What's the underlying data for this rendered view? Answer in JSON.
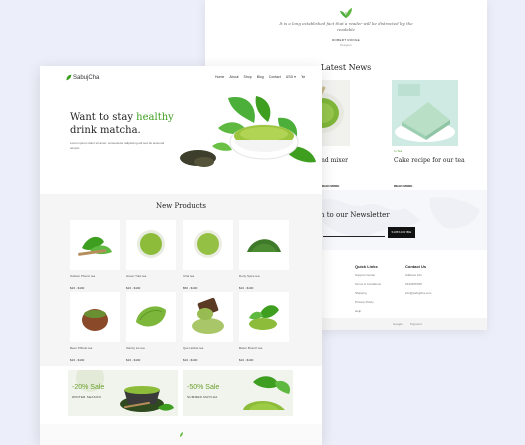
{
  "back": {
    "testimonial": {
      "quote": "It is a long established fact that a reader will be distracted by the readable",
      "author": "ROBERT RODGE",
      "role": "Designer"
    },
    "news_title": "Latest News",
    "news": [
      {
        "date": "",
        "title": "nd mixer",
        "more": "READ MORE"
      },
      {
        "date": "",
        "title": "Cake recipe for our tea",
        "more": "READ MORE"
      }
    ],
    "newsletter": {
      "title": "n to our Newsletter",
      "button": "SUBSCRIBE"
    },
    "footer": {
      "quick_links": {
        "heading": "Quick Links",
        "items": [
          "Support Center",
          "Terms & Conditions",
          "Shipping",
          "Privacy Policy",
          "Help",
          "FAQs"
        ]
      },
      "contact": {
        "heading": "Contact Us",
        "items": [
          "Address Info",
          "0123456789",
          "info@sabujcha.com"
        ]
      },
      "partial_heading": "s",
      "bottom": [
        "Google",
        "Payment",
        "",
        ""
      ]
    }
  },
  "front": {
    "brand": "SabujCha",
    "nav": [
      "Home",
      "About",
      "Shop",
      "Blog",
      "Contact",
      "USD ▾"
    ],
    "hero": {
      "line1": "Want to stay ",
      "highlight": "healthy",
      "line2": "drink matcha.",
      "desc": "Lorem ipsum dolor sit amet, consectetur adipiscing elit sed do eiusmod tempor."
    },
    "products_title": "New Products",
    "products": [
      {
        "name": "Sodium Phenix tea",
        "price": "$16 - $100"
      },
      {
        "name": "Green Tulsi tea",
        "price": "$16 - $100"
      },
      {
        "name": "Chai tea",
        "price": "$50 - $100"
      },
      {
        "name": "Dorty Spice tea",
        "price": "$16 - $100"
      },
      {
        "name": "Bees Tiffindo tea",
        "price": "$16 - $100"
      },
      {
        "name": "Sainity ice tea",
        "price": "$16 - $100"
      },
      {
        "name": "Que Hotbet tea",
        "price": "$16 - $100"
      },
      {
        "name": "Better Brunch tea",
        "price": "$16 - $100"
      }
    ],
    "banners": [
      {
        "sale": "-20% Sale",
        "sub": "WINTER SEASON"
      },
      {
        "sale": "-50% Sale",
        "sub": "SUMMER MATCHA"
      }
    ]
  },
  "colors": {
    "accent": "#3e9e1f",
    "background": "#eceef9"
  }
}
